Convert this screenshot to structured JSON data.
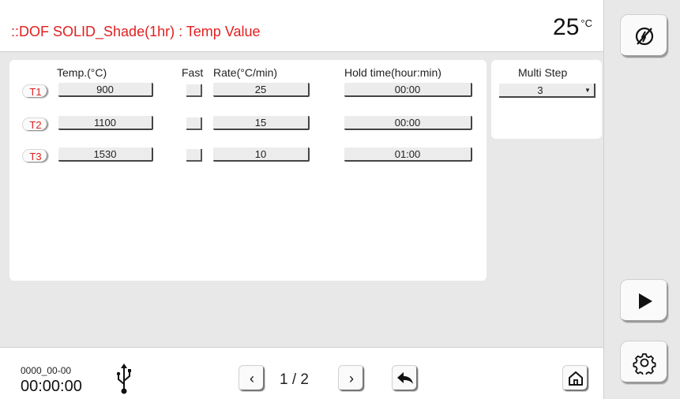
{
  "header": {
    "title": "::DOF SOLID_Shade(1hr) : Temp Value",
    "temperature": "25",
    "temperature_unit": "°C"
  },
  "table": {
    "columns": {
      "temp": "Temp.(°C)",
      "fast": "Fast",
      "rate": "Rate(°C/min)",
      "hold": "Hold time(hour:min)"
    },
    "rows": [
      {
        "label": "T1",
        "temp": "900",
        "rate": "25",
        "hold": "00:00"
      },
      {
        "label": "T2",
        "temp": "1100",
        "rate": "15",
        "hold": "00:00"
      },
      {
        "label": "T3",
        "temp": "1530",
        "rate": "10",
        "hold": "01:00"
      }
    ]
  },
  "multi_step": {
    "label": "Multi Step",
    "value": "3"
  },
  "footer": {
    "date": "0000_00-00",
    "time": "00:00:00",
    "page": "1 / 2"
  },
  "icons": {
    "power": "no-power-icon",
    "play": "play-icon",
    "settings": "gear-icon",
    "usb": "usb-icon",
    "back": "back-arrow-icon",
    "home": "home-icon"
  }
}
